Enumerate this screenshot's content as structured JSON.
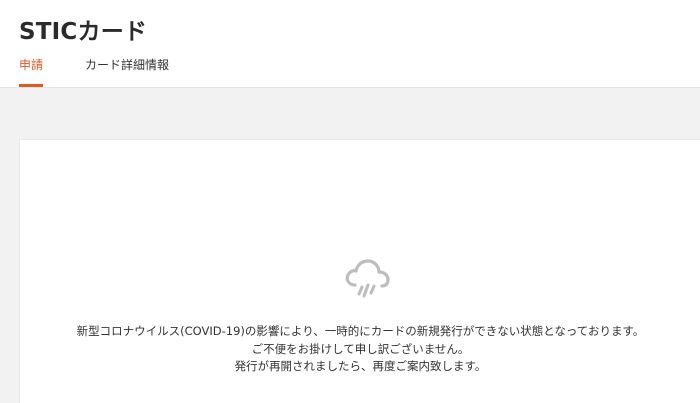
{
  "header": {
    "title": "STICカード",
    "tabs": [
      {
        "label": "申請",
        "active": true
      },
      {
        "label": "カード詳細情報",
        "active": false
      }
    ]
  },
  "notice": {
    "icon": "cloud-rain-icon",
    "lines": [
      "新型コロナウイルス(COVID-19)の影響により、一時的にカードの新規発行ができない状態となっております。",
      "ご不便をお掛けして申し訳ございません。",
      "発行が再開されましたら、再度ご案内致します。"
    ]
  },
  "colors": {
    "accent": "#e05a20",
    "background": "#f2f2f2",
    "card": "#ffffff",
    "icon": "#bdbdbd"
  }
}
